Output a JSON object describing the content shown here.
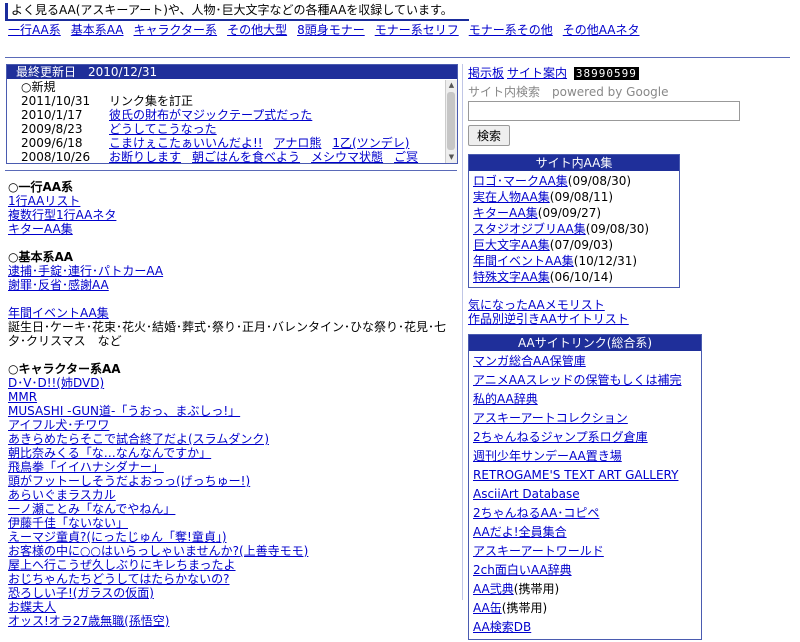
{
  "tagline": "よく見るAA(アスキーアート)や、人物･巨大文字などの各種AAを収録しています。",
  "top_nav": [
    "一行AA系",
    "基本系AA",
    "キャラクター系",
    "その他大型",
    "8頭身モナー",
    "モナー系セリフ",
    "モナー系その他",
    "その他AAネタ"
  ],
  "news": {
    "header": "最終更新日　2010/12/31",
    "rows": [
      {
        "date": "○新規",
        "links": []
      },
      {
        "date": "2011/10/31",
        "text": "リンク集を訂正",
        "links": []
      },
      {
        "date": "2010/1/17",
        "links": [
          "彼氏の財布がマジックテープ式だった"
        ]
      },
      {
        "date": "2009/8/23",
        "links": [
          "どうしてこうなった"
        ]
      },
      {
        "date": "2009/6/18",
        "links": [
          "こまけぇこたぁいいんだよ!!",
          "アナロ熊",
          "1乙(ツンデレ)"
        ]
      },
      {
        "date": "2008/10/26",
        "links": [
          "お断りします",
          "朝ごはんを食べよう",
          "メシウマ状態",
          "ご冥"
        ]
      }
    ]
  },
  "sections": [
    {
      "title": "一行AA系",
      "links": [
        "1行AAリスト",
        "複数行型1行AAネタ",
        "キターAA集"
      ]
    },
    {
      "title": "基本系AA",
      "links": [
        "逮捕･手錠･連行･パトカーAA",
        "謝罪･反省･感謝AA"
      ]
    },
    {
      "title": "",
      "links": [
        "年間イベントAA集"
      ],
      "desc": "誕生日･ケーキ･花束･花火･結婚･葬式･祭り･正月･バレンタイン･ひな祭り･花見･七夕･クリスマス　など"
    },
    {
      "title": "キャラクター系AA",
      "links": [
        "D･V･D!!(姉DVD)",
        "MMR",
        "MUSASHI -GUN道-「うおっ、まぶしっ!」",
        "アイフル犬･チワワ",
        "あきらめたらそこで試合終了だよ(スラムダンク)",
        "朝比奈みくる「な…なんなんですか」",
        "飛鳥拳「イイハナシダナー」",
        "頭がフットーしそうだよおっっ(げっちゅー!)",
        "あらいぐまラスカル",
        "一ノ瀬ことみ「なんでやねん」",
        "伊藤千佳「ないない」",
        "えーマジ童貞?(にったじゅん「奪!童貞」)",
        "お客様の中に○○はいらっしゃいませんか?(上善寺モモ)",
        "屋上へ行こうぜ久しぶりにキレちまったよ",
        "おじちゃんたちどうしてはたらかないの?",
        "恐ろしい子!(ガラスの仮面)",
        "お蝶夫人",
        "オッス!オラ27歳無職(孫悟空)"
      ]
    }
  ],
  "right": {
    "links": [
      "掲示板",
      "サイト案内"
    ],
    "counter": "38990599",
    "search_label": "サイト内検索　powered by Google",
    "search_button": "検索",
    "box1": {
      "title": "サイト内AA集",
      "items": [
        {
          "link": "ロゴ･マークAA集",
          "date": "(09/08/30)"
        },
        {
          "link": "実在人物AA集",
          "date": "(09/08/11)"
        },
        {
          "link": "キターAA集",
          "date": "(09/09/27)"
        },
        {
          "link": "スタジオジブリAA集",
          "date": "(09/08/30)"
        },
        {
          "link": "巨大文字AA集",
          "date": "(07/09/03)"
        },
        {
          "link": "年間イベントAA集",
          "date": "(10/12/31)"
        },
        {
          "link": "特殊文字AA集",
          "date": "(06/10/14)"
        }
      ]
    },
    "plain_links": [
      "気になったAAメモリスト",
      "作品別逆引きAAサイトリスト"
    ],
    "box2": {
      "title": "AAサイトリンク(総合系)",
      "items": [
        {
          "link": "マンガ総合AA保管庫"
        },
        {
          "link": "アニメAAスレッドの保管もしくは補完"
        },
        {
          "link": "私的AA辞典"
        },
        {
          "link": "アスキーアートコレクション"
        },
        {
          "link": "2ちゃんねるジャンプ系ログ倉庫"
        },
        {
          "link": "週刊少年サンデーAA置き場"
        },
        {
          "link": "RETROGAME'S TEXT ART GALLERY"
        },
        {
          "link": "AsciiArt Database"
        },
        {
          "link": "2ちゃんねるAA･コピペ"
        },
        {
          "link": "AAだよ!全員集合"
        },
        {
          "link": "アスキーアートワールド"
        },
        {
          "link": "2ch面白いAA辞典"
        },
        {
          "link": "AA弐典",
          "suffix": "(携帯用)"
        },
        {
          "link": "AA缶",
          "suffix": "(携帯用)"
        },
        {
          "link": "AA検索DB"
        }
      ]
    }
  }
}
